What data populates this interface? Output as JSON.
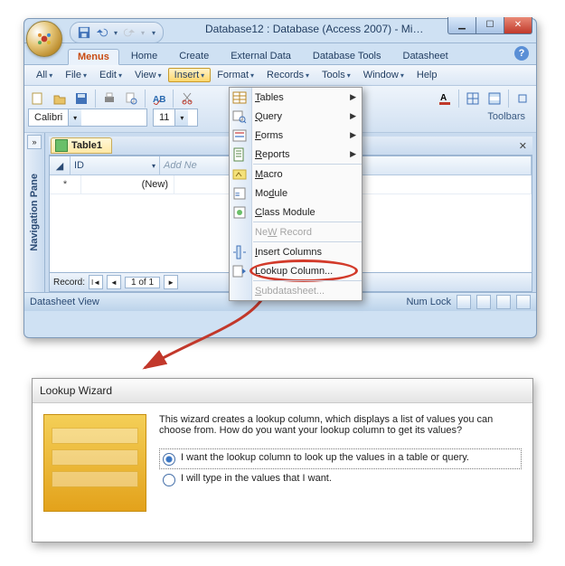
{
  "window": {
    "title": "Database12 : Database (Access 2007) - Micro..."
  },
  "ribbon_tabs": [
    "Menus",
    "Home",
    "Create",
    "External Data",
    "Database Tools",
    "Datasheet"
  ],
  "ribbon_active": "Menus",
  "menubar": [
    "All",
    "File",
    "Edit",
    "View",
    "Insert",
    "Format",
    "Records",
    "Tools",
    "Window",
    "Help"
  ],
  "menubar_open": "Insert",
  "font": {
    "name": "Calibri",
    "size": "11"
  },
  "toolbar_section_label": "Toolbars",
  "navpane_label": "Navigation Pane",
  "document_tab": "Table1",
  "columns": {
    "id": "ID",
    "addnew": "Add Ne"
  },
  "row_new_label": "(New)",
  "record_nav": {
    "label": "Record:",
    "position": "1 of 1"
  },
  "statusbar": {
    "left": "Datasheet View",
    "right": "Num Lock"
  },
  "insert_menu": [
    {
      "label": "Tables",
      "key": "T",
      "sub": true,
      "icon": "table-icon"
    },
    {
      "label": "Query",
      "key": "Q",
      "sub": true,
      "icon": "query-icon"
    },
    {
      "label": "Forms",
      "key": "F",
      "sub": true,
      "icon": "form-icon"
    },
    {
      "label": "Reports",
      "key": "R",
      "sub": true,
      "icon": "report-icon"
    },
    {
      "sep": true
    },
    {
      "label": "Macro",
      "key": "M",
      "icon": "macro-icon"
    },
    {
      "label": "Module",
      "key": "d",
      "before": "Mo",
      "after": "ule",
      "icon": "module-icon"
    },
    {
      "label": "Class Module",
      "key": "C",
      "icon": "class-module-icon"
    },
    {
      "sep": true
    },
    {
      "label": "New Record",
      "key": "W",
      "before": "Ne",
      "after": " Record",
      "disabled": true
    },
    {
      "sep": true
    },
    {
      "label": "Insert Columns",
      "key": "I",
      "icon": "insert-col-icon"
    },
    {
      "label": "Lookup Column...",
      "key": "L",
      "icon": "lookup-icon",
      "callout": true
    },
    {
      "sep": true
    },
    {
      "label": "Subdatasheet...",
      "key": "S",
      "disabled": true
    }
  ],
  "wizard": {
    "title": "Lookup Wizard",
    "intro": "This wizard creates a lookup column, which displays a list of values you can choose from.  How do you want your lookup column to get its values?",
    "opt1": "I want the lookup column to look up the values in a table or query.",
    "opt2": "I will type in the values that I want."
  }
}
